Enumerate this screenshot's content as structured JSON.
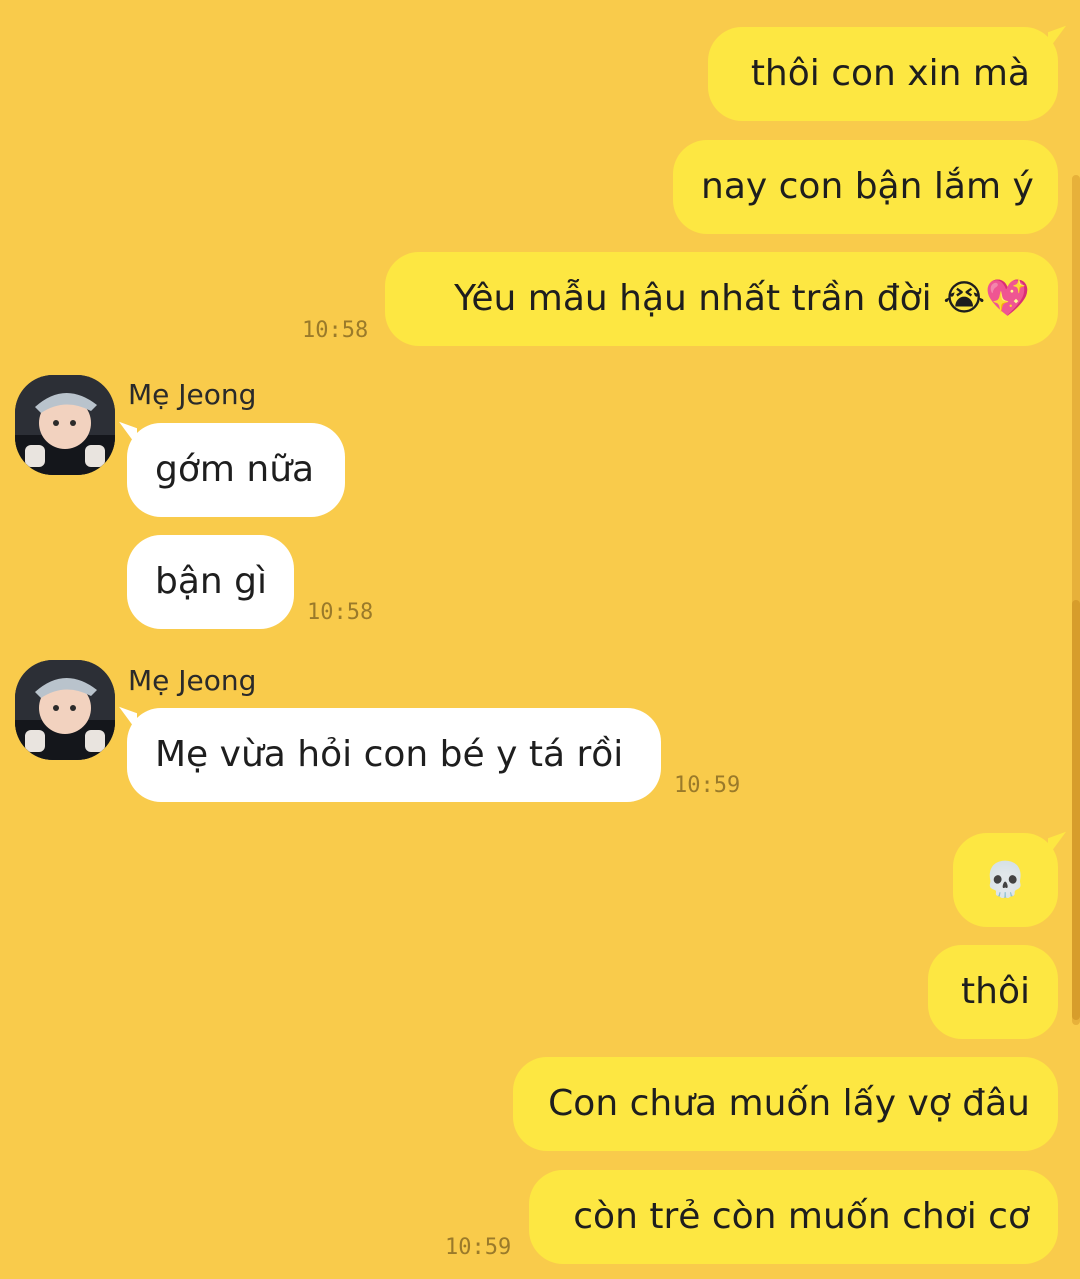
{
  "messages": {
    "m1": "thôi con xin mà",
    "m2": "nay con bận lắm ý",
    "m3": "Yêu mẫu hậu nhất trần đời 😭💖",
    "t1": "10:58",
    "sender1": "Mẹ Jeong",
    "r1": "gớm nữa",
    "r2": "bận gì",
    "t2": "10:58",
    "sender2": "Mẹ Jeong",
    "r3": "Mẹ vừa hỏi con bé y tá rồi",
    "t3": "10:59",
    "m4": "💀",
    "m5": "thôi",
    "m6": "Con chưa muốn lấy vợ đâu",
    "m7": "còn trẻ còn muốn chơi cơ",
    "t4": "10:59"
  },
  "colors": {
    "background": "#f9cb4b",
    "outgoing_bubble": "#fde742",
    "incoming_bubble": "#ffffff",
    "timestamp": "#9a7a2a"
  },
  "icons": {
    "avatar": "user-avatar-photo"
  }
}
